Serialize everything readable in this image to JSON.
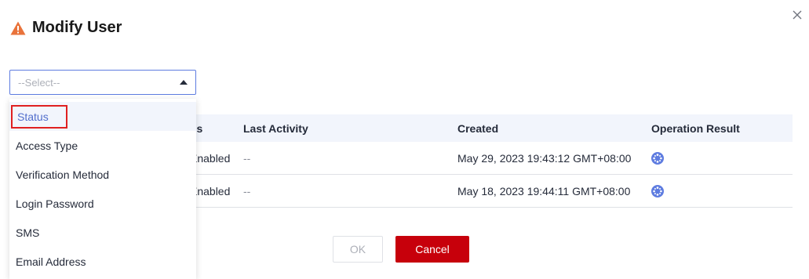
{
  "dialog": {
    "title": "Modify User",
    "close_symbol": "×",
    "title_icon": "warning-icon",
    "accent_warning": "#e9733b"
  },
  "select": {
    "placeholder": "--Select--",
    "options": [
      {
        "label": "Status",
        "active": true
      },
      {
        "label": "Access Type"
      },
      {
        "label": "Verification Method"
      },
      {
        "label": "Login Password"
      },
      {
        "label": "SMS"
      },
      {
        "label": "Email Address"
      }
    ]
  },
  "table": {
    "headers": [
      "us",
      "Last Activity",
      "Created",
      "Operation Result"
    ],
    "rows": [
      {
        "status": "Enabled",
        "last_activity": "--",
        "created": "May 29, 2023 19:43:12 GMT+08:00",
        "result_icon": "loading-icon"
      },
      {
        "status": "Enabled",
        "last_activity": "--",
        "created": "May 18, 2023 19:44:11 GMT+08:00",
        "result_icon": "loading-icon"
      }
    ]
  },
  "footer": {
    "ok_label": "OK",
    "cancel_label": "Cancel"
  },
  "colors": {
    "primary": "#5e7ce0",
    "danger": "#c7000b",
    "highlight_box": "#e02020"
  }
}
